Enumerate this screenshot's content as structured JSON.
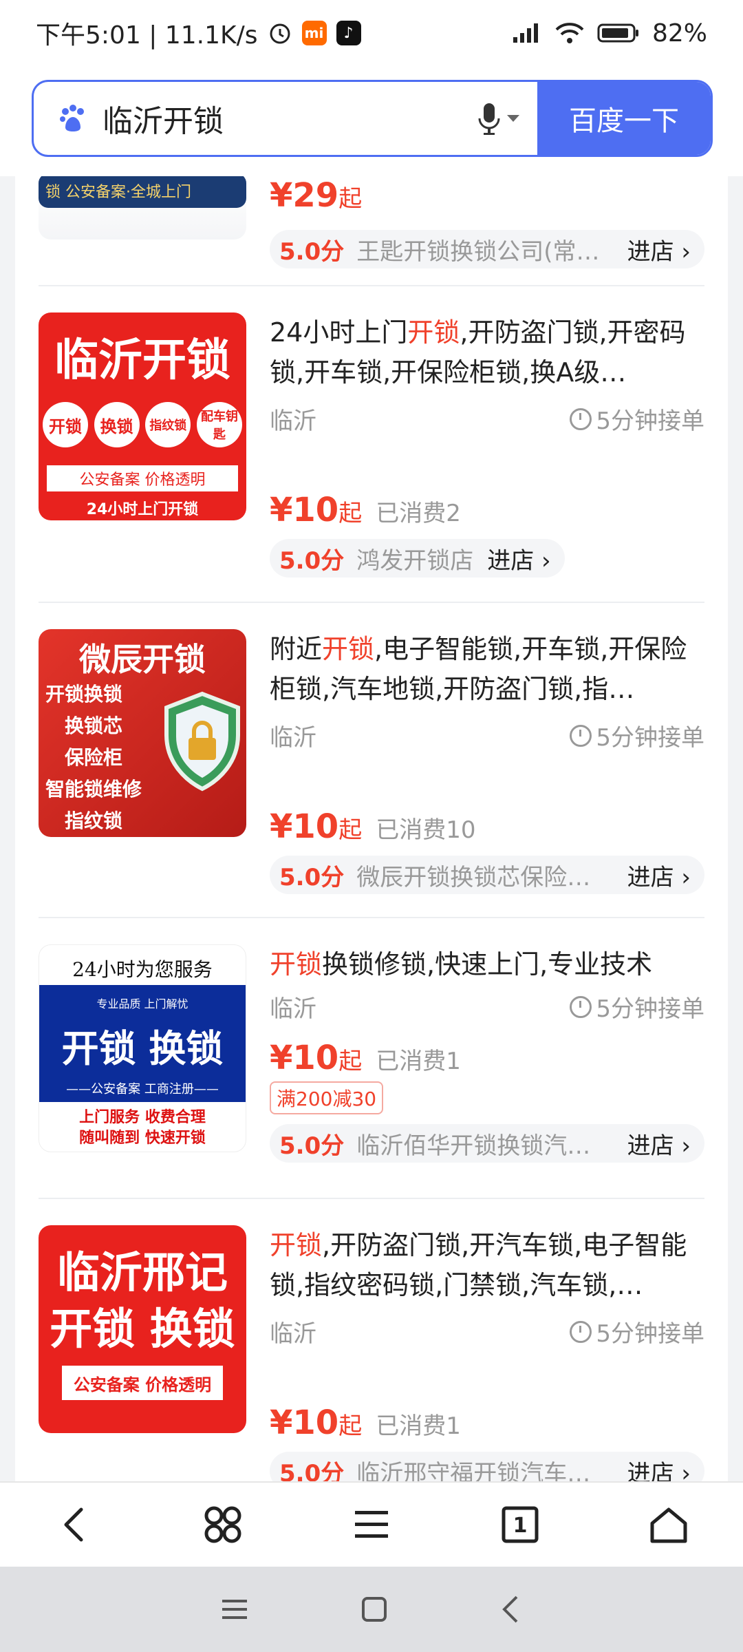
{
  "status_bar": {
    "time_speed": "下午5:01 | 11.1K/s",
    "mi_badge": "mi",
    "battery": "82%"
  },
  "search": {
    "query": "临沂开锁",
    "button": "百度一下"
  },
  "partial_item": {
    "banner": "锁  公安备案·全城上门",
    "price": "¥29",
    "price_unit": "起",
    "score": "5.0分",
    "shop": "王匙开锁换锁公司(常…",
    "enter": "进店"
  },
  "items": [
    {
      "title_hl": "",
      "title_pre": "24小时上门",
      "title_hl2": "开锁",
      "title_post": ",开防盗门锁,开密码锁,开车锁,开保险柜锁,换A级…",
      "location": "临沂",
      "eta": "5分钟接单",
      "price": "¥10",
      "price_unit": "起",
      "sold": "已消费2",
      "coupon": "",
      "score": "5.0分",
      "shop": "鸿发开锁店",
      "enter": "进店",
      "thumb": {
        "line1": "临沂开锁",
        "circles": [
          "开锁",
          "换锁",
          "指纹锁",
          "配车钥匙"
        ],
        "line3": "公安备案 价格透明",
        "line4": "24小时上门开锁",
        "bg": "#e8221e"
      }
    },
    {
      "title_pre": "附近",
      "title_hl2": "开锁",
      "title_post": ",电子智能锁,开车锁,开保险柜锁,汽车地锁,开防盗门锁,指…",
      "location": "临沂",
      "eta": "5分钟接单",
      "price": "¥10",
      "price_unit": "起",
      "sold": "已消费10",
      "coupon": "",
      "score": "5.0分",
      "shop": "微辰开锁换锁芯保险…",
      "enter": "进店",
      "thumb": {
        "line1": "微辰开锁",
        "lines": [
          "开锁换锁",
          "换锁芯",
          "保险柜",
          "智能锁维修",
          "指纹锁"
        ],
        "bg": "#d8281f"
      }
    },
    {
      "title_pre": "",
      "title_hl2": "开锁",
      "title_post": "换锁修锁,快速上门,专业技术",
      "location": "临沂",
      "eta": "5分钟接单",
      "price": "¥10",
      "price_unit": "起",
      "sold": "已消费1",
      "coupon": "满200减30",
      "score": "5.0分",
      "shop": "临沂佰华开锁换锁汽…",
      "enter": "进店",
      "thumb": {
        "top": "24小时为您服务",
        "sub": "专业品质 上门解忧",
        "big": "开锁 换锁",
        "reg": "——公安备案 工商注册——",
        "l1": "上门服务  收费合理",
        "l2": "随叫随到  快速开锁"
      }
    },
    {
      "title_pre": "",
      "title_hl2": "开锁",
      "title_post": ",开防盗门锁,开汽车锁,电子智能锁,指纹密码锁,门禁锁,汽车锁,…",
      "location": "临沂",
      "eta": "5分钟接单",
      "price": "¥10",
      "price_unit": "起",
      "sold": "已消费1",
      "coupon": "",
      "score": "5.0分",
      "shop": "临沂邢守福开锁汽车…",
      "enter": "进店",
      "thumb": {
        "line1": "临沂邢记",
        "line2": "开锁 换锁",
        "tag": "公安备案 价格透明",
        "bg": "#e8221e"
      }
    }
  ],
  "colors": {
    "accent": "#4e6ef2",
    "highlight": "#f0412b"
  }
}
